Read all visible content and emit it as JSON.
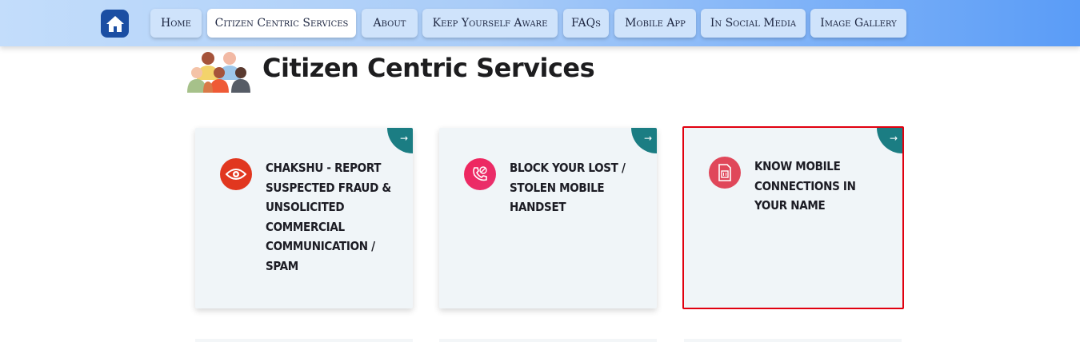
{
  "nav": {
    "home_icon": "home-icon",
    "items": [
      {
        "label": "Home"
      },
      {
        "label": "Citizen Centric Services"
      },
      {
        "label": "About"
      },
      {
        "label": "Keep Yourself Aware"
      },
      {
        "label": "FAQs"
      },
      {
        "label": "Mobile App"
      },
      {
        "label": "In Social Media"
      },
      {
        "label": "Image Gallery"
      }
    ],
    "active_index": 1
  },
  "page": {
    "title": "Citizen Centric Services",
    "title_icon": "people-group-icon"
  },
  "cards": [
    {
      "label": "Chakshu - Report Suspected Fraud & Unsolicited Commercial Communication / Spam",
      "icon": "eye-icon",
      "icon_color": "#e1371f",
      "arrow": "→"
    },
    {
      "label": "Block Your Lost / Stolen Mobile Handset",
      "icon": "phone-block-icon",
      "icon_color": "#e8265e",
      "arrow": "→"
    },
    {
      "label": "Know Mobile Connections in Your Name",
      "icon": "sim-card-icon",
      "icon_color": "#e0475a",
      "arrow": "→"
    }
  ],
  "colors": {
    "nav_gradient_start": "#c3ddfb",
    "nav_gradient_end": "#5a9cf7",
    "corner_teal": "#1b7d83",
    "selection_red": "#e1000f",
    "card_bg": "#f0f5f8"
  }
}
